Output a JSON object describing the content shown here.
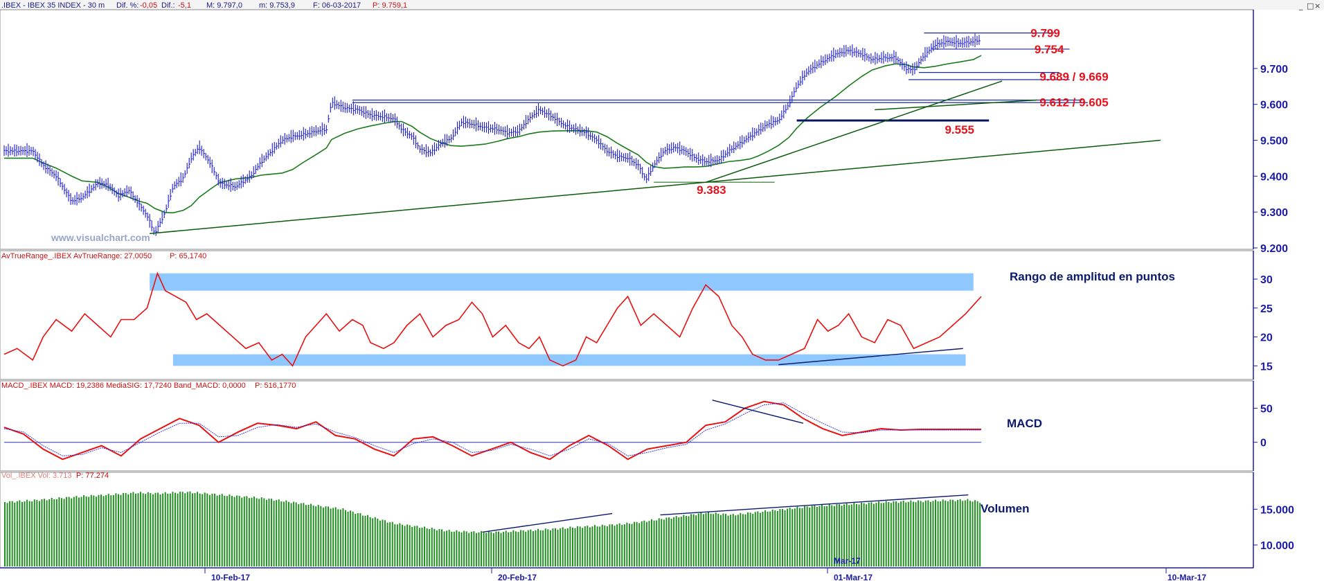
{
  "header": {
    "title": ".IBEX - IBEX 35 INDEX - 30 m",
    "dif_pct_label": "Dif. %:",
    "dif_pct_value": "-0,05",
    "dif_label": "Dif.:",
    "dif_value": "-5,1",
    "max": "M: 9.797,0",
    "min": "m: 9.753,9",
    "date": "F: 06-03-2017",
    "price": "P: 9.759,1"
  },
  "watermark": "www.visualchart.com",
  "window_buttons": [
    "_",
    "□",
    "×"
  ],
  "panels": {
    "atr": {
      "title": "AvTrueRange_.IBEX AvTrueRange: 27,0050",
      "price": "P: 65,1740",
      "note": "Rango de amplitud en puntos"
    },
    "macd": {
      "title": "MACD_.IBEX MACD: 19,2386 MediaSIG: 17,7240 Band_MACD: 0,0000",
      "price": "P: 516,1770",
      "note": "MACD"
    },
    "vol": {
      "title": "Vol_.IBEX Vol: 3.713",
      "price": "P: 77.274",
      "note": "Volumen"
    }
  },
  "x_axis": {
    "labels": [
      "10-Feb-17",
      "20-Feb-17",
      "01-Mar-17",
      "10-Mar-17"
    ],
    "extra_label": "Mar-17"
  },
  "colors": {
    "price_bars": "#1a1ad0",
    "moving_average": "#1a7a1a",
    "atr_line": "#e81010",
    "macd_line": "#e81010",
    "macd_signal": "#2a2ad8",
    "volume": "#1f8f1f",
    "levels": "#1a2a9a",
    "trend": "#0a5a0a",
    "bands": "#8ec8ff",
    "annotation_text": "#e8101a"
  },
  "chart_data": [
    {
      "type": "candlestick",
      "panel": "price",
      "ylim": [
        9200,
        9860
      ],
      "y_ticks": [
        "9.700",
        "9.600",
        "9.500",
        "9.400",
        "9.300",
        "9.200"
      ],
      "y_tick_values": [
        9700,
        9600,
        9500,
        9400,
        9300,
        9200
      ],
      "annotations": [
        {
          "text": "9.799",
          "value": 9799
        },
        {
          "text": "9.754",
          "value": 9754
        },
        {
          "text": "9.689 / 9.669",
          "value": 9689,
          "value2": 9669
        },
        {
          "text": "9.612 / 9.605",
          "value": 9612,
          "value2": 9605
        },
        {
          "text": "9.555",
          "value": 9555
        },
        {
          "text": "9.383",
          "value": 9383
        }
      ],
      "close_path": [
        [
          0,
          9470
        ],
        [
          22,
          9470
        ],
        [
          30,
          9430
        ],
        [
          40,
          9400
        ],
        [
          52,
          9330
        ],
        [
          60,
          9340
        ],
        [
          72,
          9380
        ],
        [
          80,
          9375
        ],
        [
          88,
          9345
        ],
        [
          96,
          9360
        ],
        [
          104,
          9320
        ],
        [
          110,
          9290
        ],
        [
          116,
          9240
        ],
        [
          124,
          9300
        ],
        [
          130,
          9370
        ],
        [
          138,
          9395
        ],
        [
          144,
          9450
        ],
        [
          150,
          9480
        ],
        [
          158,
          9440
        ],
        [
          166,
          9380
        ],
        [
          178,
          9370
        ],
        [
          190,
          9400
        ],
        [
          198,
          9440
        ],
        [
          206,
          9470
        ],
        [
          214,
          9500
        ],
        [
          222,
          9510
        ],
        [
          230,
          9515
        ],
        [
          240,
          9525
        ],
        [
          248,
          9530
        ],
        [
          252,
          9605
        ],
        [
          262,
          9590
        ],
        [
          272,
          9585
        ],
        [
          282,
          9570
        ],
        [
          292,
          9565
        ],
        [
          300,
          9560
        ],
        [
          306,
          9530
        ],
        [
          314,
          9510
        ],
        [
          320,
          9475
        ],
        [
          328,
          9465
        ],
        [
          336,
          9490
        ],
        [
          344,
          9505
        ],
        [
          352,
          9550
        ],
        [
          360,
          9545
        ],
        [
          370,
          9535
        ],
        [
          380,
          9530
        ],
        [
          388,
          9520
        ],
        [
          396,
          9525
        ],
        [
          404,
          9560
        ],
        [
          412,
          9585
        ],
        [
          422,
          9565
        ],
        [
          432,
          9540
        ],
        [
          440,
          9530
        ],
        [
          448,
          9520
        ],
        [
          456,
          9500
        ],
        [
          464,
          9470
        ],
        [
          472,
          9455
        ],
        [
          480,
          9450
        ],
        [
          488,
          9430
        ],
        [
          494,
          9390
        ],
        [
          500,
          9430
        ],
        [
          508,
          9470
        ],
        [
          516,
          9480
        ],
        [
          524,
          9470
        ],
        [
          532,
          9450
        ],
        [
          540,
          9440
        ],
        [
          550,
          9445
        ],
        [
          558,
          9470
        ],
        [
          566,
          9490
        ],
        [
          574,
          9510
        ],
        [
          580,
          9525
        ],
        [
          588,
          9545
        ],
        [
          596,
          9555
        ],
        [
          604,
          9600
        ],
        [
          610,
          9650
        ],
        [
          618,
          9690
        ],
        [
          628,
          9715
        ],
        [
          640,
          9740
        ],
        [
          650,
          9750
        ],
        [
          660,
          9740
        ],
        [
          668,
          9725
        ],
        [
          678,
          9730
        ],
        [
          686,
          9730
        ],
        [
          694,
          9700
        ],
        [
          700,
          9695
        ],
        [
          708,
          9735
        ],
        [
          716,
          9765
        ],
        [
          726,
          9775
        ],
        [
          736,
          9770
        ],
        [
          746,
          9775
        ],
        [
          752,
          9780
        ]
      ]
    },
    {
      "type": "line",
      "panel": "atr",
      "ylim": [
        13,
        33
      ],
      "y_ticks": [
        "30",
        "25",
        "20",
        "15"
      ],
      "y_tick_values": [
        30,
        25,
        20,
        15
      ],
      "x": [
        0,
        10,
        22,
        30,
        40,
        52,
        62,
        72,
        82,
        90,
        100,
        110,
        118,
        124,
        132,
        140,
        148,
        156,
        166,
        176,
        186,
        196,
        206,
        214,
        222,
        232,
        240,
        248,
        258,
        268,
        276,
        282,
        292,
        300,
        310,
        320,
        330,
        340,
        350,
        360,
        368,
        376,
        386,
        396,
        404,
        412,
        420,
        430,
        440,
        448,
        456,
        464,
        472,
        480,
        490,
        500,
        510,
        520,
        530,
        540,
        550,
        560,
        568,
        576,
        586,
        596,
        606,
        616,
        626,
        634,
        642,
        650,
        660,
        670,
        680,
        690,
        700,
        710,
        720,
        730,
        740,
        748,
        752
      ],
      "values": [
        17,
        18,
        16,
        20,
        23,
        21,
        24,
        22,
        20,
        23,
        23,
        25,
        31,
        28,
        27,
        26,
        23,
        24,
        22,
        20,
        18,
        19,
        16,
        17,
        15,
        20,
        22,
        24,
        21,
        23,
        22,
        19,
        18,
        19,
        22,
        24,
        20,
        22,
        23,
        26,
        24,
        20,
        22,
        19,
        18,
        20,
        16,
        15,
        16,
        20,
        19,
        22,
        25,
        27,
        22,
        24,
        22,
        20,
        25,
        29,
        27,
        22,
        20,
        17,
        16,
        16,
        17,
        18,
        23,
        21,
        22,
        24,
        20,
        19,
        23,
        22,
        18,
        19,
        20,
        22,
        24,
        26,
        27
      ],
      "bands": [
        [
          28,
          31
        ],
        [
          15,
          17
        ]
      ]
    },
    {
      "type": "line",
      "panel": "macd",
      "ylim": [
        -40,
        75
      ],
      "y_ticks": [
        "50",
        "0"
      ],
      "y_tick_values": [
        50,
        0
      ],
      "series": [
        {
          "name": "MACD",
          "x": [
            0,
            15,
            30,
            45,
            60,
            75,
            90,
            105,
            120,
            135,
            150,
            165,
            180,
            195,
            210,
            225,
            240,
            255,
            270,
            285,
            300,
            315,
            330,
            345,
            360,
            375,
            390,
            405,
            420,
            435,
            450,
            465,
            480,
            495,
            510,
            525,
            540,
            555,
            570,
            585,
            600,
            615,
            630,
            645,
            660,
            675,
            690,
            705,
            720,
            735,
            750,
            752
          ],
          "values": [
            22,
            12,
            -10,
            -25,
            -15,
            -5,
            -20,
            5,
            20,
            35,
            25,
            0,
            15,
            28,
            25,
            20,
            30,
            10,
            5,
            -10,
            -20,
            5,
            8,
            -5,
            -20,
            -10,
            0,
            -15,
            -25,
            -5,
            10,
            -5,
            -25,
            -10,
            -5,
            0,
            25,
            30,
            50,
            60,
            55,
            35,
            20,
            10,
            15,
            20,
            18,
            19,
            19,
            19,
            19,
            19
          ],
          "color": "#e81010"
        },
        {
          "name": "MediaSIG",
          "x": [
            0,
            15,
            30,
            45,
            60,
            75,
            90,
            105,
            120,
            135,
            150,
            165,
            180,
            195,
            210,
            225,
            240,
            255,
            270,
            285,
            300,
            315,
            330,
            345,
            360,
            375,
            390,
            405,
            420,
            435,
            450,
            465,
            480,
            495,
            510,
            525,
            540,
            555,
            570,
            585,
            600,
            615,
            630,
            645,
            660,
            675,
            690,
            705,
            720,
            735,
            750,
            752
          ],
          "values": [
            20,
            15,
            -5,
            -20,
            -18,
            -8,
            -15,
            0,
            15,
            28,
            28,
            8,
            10,
            22,
            26,
            22,
            27,
            15,
            7,
            -5,
            -15,
            -2,
            5,
            0,
            -15,
            -12,
            -3,
            -10,
            -20,
            -10,
            5,
            -2,
            -20,
            -15,
            -8,
            -3,
            18,
            27,
            42,
            55,
            58,
            42,
            28,
            15,
            14,
            18,
            18,
            18,
            18,
            18,
            18,
            18
          ],
          "color": "#2a2ad8"
        }
      ]
    },
    {
      "type": "bar",
      "panel": "volume",
      "ylim": [
        7000,
        19000
      ],
      "y_ticks": [
        "15.000",
        "10.000"
      ],
      "y_tick_values": [
        15000,
        10000
      ],
      "x": [
        0,
        20,
        40,
        60,
        80,
        100,
        120,
        140,
        160,
        180,
        200,
        220,
        240,
        260,
        280,
        300,
        320,
        340,
        360,
        380,
        400,
        420,
        440,
        460,
        480,
        500,
        520,
        540,
        560,
        580,
        600,
        620,
        640,
        660,
        680,
        700,
        720,
        740,
        752
      ],
      "values": [
        16000,
        16200,
        16500,
        16800,
        17000,
        17300,
        17200,
        17400,
        17100,
        16800,
        16500,
        16000,
        15500,
        15000,
        14000,
        13000,
        12500,
        12000,
        11800,
        11800,
        12000,
        12200,
        12500,
        12700,
        13000,
        13500,
        14000,
        14500,
        14200,
        14600,
        15000,
        15400,
        15600,
        15800,
        16000,
        16100,
        16200,
        16300,
        16000
      ]
    }
  ]
}
